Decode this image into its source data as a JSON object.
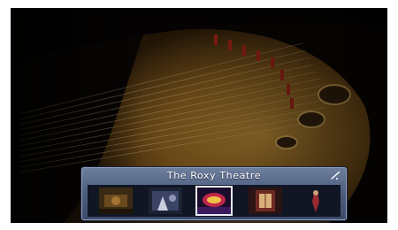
{
  "osd": {
    "title": "The Roxy Theatre",
    "status_icon": "edit-pencil-icon",
    "selected_index": 2,
    "thumbnails": [
      {
        "name": "scene-thumb-1",
        "selected": false
      },
      {
        "name": "scene-thumb-2",
        "selected": false
      },
      {
        "name": "scene-thumb-3",
        "selected": true
      },
      {
        "name": "scene-thumb-4",
        "selected": false
      },
      {
        "name": "scene-thumb-5",
        "selected": false
      }
    ]
  },
  "background": {
    "subject": "piano-interior"
  },
  "colors": {
    "panel": "#4f5f80",
    "highlight": "#e9eef8",
    "wood": "#b8862f"
  }
}
